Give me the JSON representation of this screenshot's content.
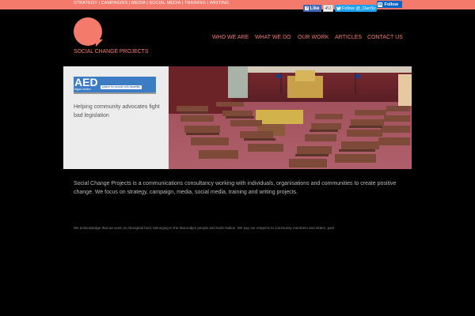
{
  "topbar": {
    "links": "STRATEGY | CAMPAIGNS | MEDIA | SOCIAL MEDIA | TRAINING | WRITING",
    "facebook_like": "Like",
    "facebook_count": "453",
    "twitter_follow": "Follow @_DanSc",
    "linkedin_follow": "Follow",
    "linkedin_brand": "in"
  },
  "logo": {
    "text": "SOCIAL CHANGE PROJECTS"
  },
  "nav": [
    {
      "label": "WHO WE ARE"
    },
    {
      "label": "WHAT WE DO"
    },
    {
      "label": "OUR WORK"
    },
    {
      "label": "ARTICLES"
    },
    {
      "label": "CONTACT US"
    }
  ],
  "hero": {
    "aed_logo_title": "AED",
    "aed_logo_subtitle": "legal centre",
    "aed_logo_tagline": "justice for people with disability",
    "caption": "Helping community advocates fight bad legislation"
  },
  "intro": "Social Change Projects is a communications consultancy working with individuals, organisations and communities to create positive change. We focus on strategy, campaign, media, social media, training and writing projects.",
  "acknowledgement": "We acknowledge that we work on Aboriginal land, belonging to the Wurundjeri people and Kulin Nation. We pay our respects to community members and elders, past",
  "colors": {
    "accent": "#f47a6b",
    "background": "#000000"
  }
}
